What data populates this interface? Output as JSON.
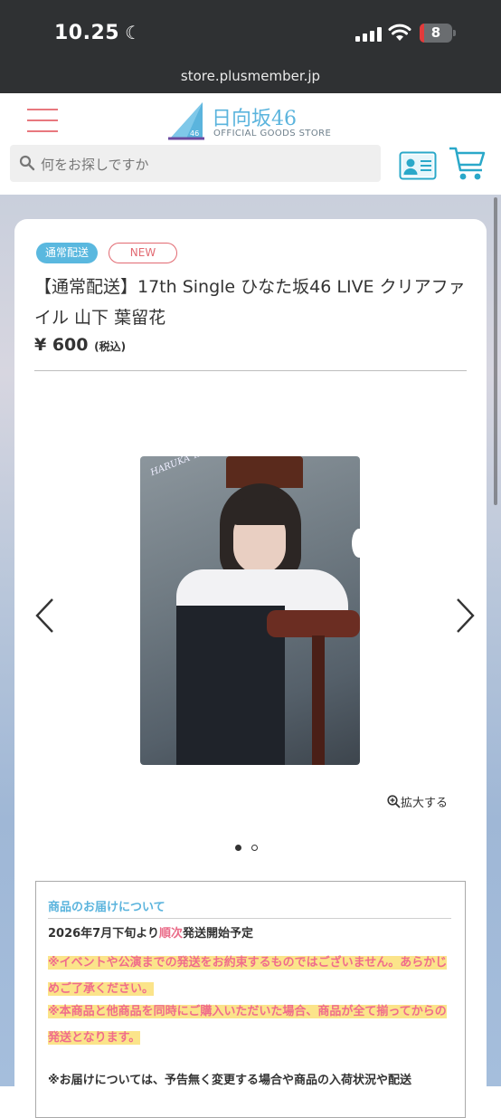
{
  "status_bar": {
    "time": "10.25",
    "battery": "8",
    "url": "store.plusmember.jp"
  },
  "header": {
    "logo_title": "日向坂46",
    "logo_subtitle": "OFFICIAL GOODS STORE",
    "logo_badge": "46",
    "search_placeholder": "何をお探しですか"
  },
  "product": {
    "tag_delivery": "通常配送",
    "tag_new": "NEW",
    "title": "【通常配送】17th Single ひなた坂46 LIVE クリアファイル 山下 葉留花",
    "price": "¥ 600",
    "tax_note": "(税込)",
    "image_signature": "HARUKA YAMASHITA",
    "zoom_label": "拡大する",
    "carousel": {
      "total": 2,
      "current": 1
    }
  },
  "delivery": {
    "heading": "商品のお届けについて",
    "schedule_prefix": "2026年7月下旬より",
    "schedule_emph": "順次",
    "schedule_suffix": "発送開始予定",
    "note1": "※イベントや公演までの発送をお約束するものではございません。あらかじめご了承ください。",
    "note2": "※本商品と他商品を同時にご購入いただいた場合、商品が全て揃ってからの発送となります。",
    "footer": "※お届けについては、予告無く変更する場合や商品の入荷状況や配送"
  },
  "colors": {
    "brand_blue": "#5bb4dd",
    "accent_pink": "#e8787e",
    "highlight": "#fbe48a",
    "alert_pink": "#f06c8c"
  }
}
